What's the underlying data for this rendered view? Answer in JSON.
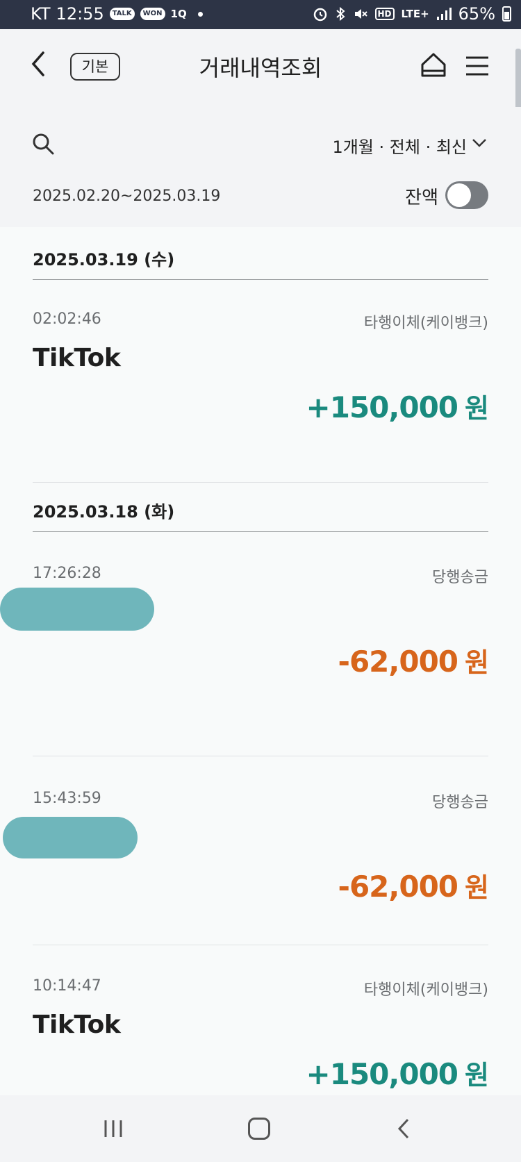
{
  "status_bar": {
    "carrier": "KT",
    "time": "12:55",
    "app_badges": [
      "TALK",
      "WON",
      "1Q"
    ],
    "network": "LTE+",
    "hd": "HD",
    "battery": "65%"
  },
  "header": {
    "tag": "기본",
    "title": "거래내역조회"
  },
  "filter": {
    "summary": "1개월 · 전체 · 최신",
    "date_range": "2025.02.20~2025.03.19",
    "balance_label": "잔액",
    "balance_toggle_on": false
  },
  "groups": [
    {
      "date": "2025.03.19 (수)",
      "transactions": [
        {
          "time": "02:02:46",
          "type": "타행이체(케이뱅크)",
          "name": "TikTok",
          "sign": "+",
          "amount": "150,000",
          "unit": "원"
        }
      ]
    },
    {
      "date": "2025.03.18 (화)",
      "transactions": [
        {
          "time": "17:26:28",
          "type": "당행송금",
          "name": "",
          "sign": "-",
          "amount": "62,000",
          "unit": "원"
        },
        {
          "time": "15:43:59",
          "type": "당행송금",
          "name": "",
          "sign": "-",
          "amount": "62,000",
          "unit": "원"
        },
        {
          "time": "10:14:47",
          "type": "타행이체(케이뱅크)",
          "name": "TikTok",
          "sign": "+",
          "amount": "150,000",
          "unit": "원"
        }
      ]
    }
  ],
  "colors": {
    "credit": "#1a8a7e",
    "debit": "#d7651b",
    "redaction": "#6fb6bb"
  }
}
